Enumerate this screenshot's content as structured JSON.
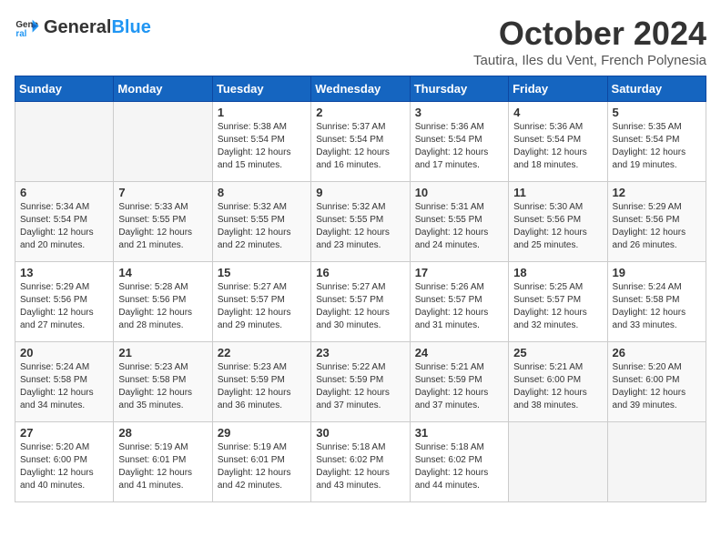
{
  "logo": {
    "general": "General",
    "blue": "Blue"
  },
  "title": "October 2024",
  "location": "Tautira, Iles du Vent, French Polynesia",
  "days_of_week": [
    "Sunday",
    "Monday",
    "Tuesday",
    "Wednesday",
    "Thursday",
    "Friday",
    "Saturday"
  ],
  "weeks": [
    [
      {
        "day": "",
        "sunrise": "",
        "sunset": "",
        "daylight": ""
      },
      {
        "day": "",
        "sunrise": "",
        "sunset": "",
        "daylight": ""
      },
      {
        "day": "1",
        "sunrise": "Sunrise: 5:38 AM",
        "sunset": "Sunset: 5:54 PM",
        "daylight": "Daylight: 12 hours and 15 minutes."
      },
      {
        "day": "2",
        "sunrise": "Sunrise: 5:37 AM",
        "sunset": "Sunset: 5:54 PM",
        "daylight": "Daylight: 12 hours and 16 minutes."
      },
      {
        "day": "3",
        "sunrise": "Sunrise: 5:36 AM",
        "sunset": "Sunset: 5:54 PM",
        "daylight": "Daylight: 12 hours and 17 minutes."
      },
      {
        "day": "4",
        "sunrise": "Sunrise: 5:36 AM",
        "sunset": "Sunset: 5:54 PM",
        "daylight": "Daylight: 12 hours and 18 minutes."
      },
      {
        "day": "5",
        "sunrise": "Sunrise: 5:35 AM",
        "sunset": "Sunset: 5:54 PM",
        "daylight": "Daylight: 12 hours and 19 minutes."
      }
    ],
    [
      {
        "day": "6",
        "sunrise": "Sunrise: 5:34 AM",
        "sunset": "Sunset: 5:54 PM",
        "daylight": "Daylight: 12 hours and 20 minutes."
      },
      {
        "day": "7",
        "sunrise": "Sunrise: 5:33 AM",
        "sunset": "Sunset: 5:55 PM",
        "daylight": "Daylight: 12 hours and 21 minutes."
      },
      {
        "day": "8",
        "sunrise": "Sunrise: 5:32 AM",
        "sunset": "Sunset: 5:55 PM",
        "daylight": "Daylight: 12 hours and 22 minutes."
      },
      {
        "day": "9",
        "sunrise": "Sunrise: 5:32 AM",
        "sunset": "Sunset: 5:55 PM",
        "daylight": "Daylight: 12 hours and 23 minutes."
      },
      {
        "day": "10",
        "sunrise": "Sunrise: 5:31 AM",
        "sunset": "Sunset: 5:55 PM",
        "daylight": "Daylight: 12 hours and 24 minutes."
      },
      {
        "day": "11",
        "sunrise": "Sunrise: 5:30 AM",
        "sunset": "Sunset: 5:56 PM",
        "daylight": "Daylight: 12 hours and 25 minutes."
      },
      {
        "day": "12",
        "sunrise": "Sunrise: 5:29 AM",
        "sunset": "Sunset: 5:56 PM",
        "daylight": "Daylight: 12 hours and 26 minutes."
      }
    ],
    [
      {
        "day": "13",
        "sunrise": "Sunrise: 5:29 AM",
        "sunset": "Sunset: 5:56 PM",
        "daylight": "Daylight: 12 hours and 27 minutes."
      },
      {
        "day": "14",
        "sunrise": "Sunrise: 5:28 AM",
        "sunset": "Sunset: 5:56 PM",
        "daylight": "Daylight: 12 hours and 28 minutes."
      },
      {
        "day": "15",
        "sunrise": "Sunrise: 5:27 AM",
        "sunset": "Sunset: 5:57 PM",
        "daylight": "Daylight: 12 hours and 29 minutes."
      },
      {
        "day": "16",
        "sunrise": "Sunrise: 5:27 AM",
        "sunset": "Sunset: 5:57 PM",
        "daylight": "Daylight: 12 hours and 30 minutes."
      },
      {
        "day": "17",
        "sunrise": "Sunrise: 5:26 AM",
        "sunset": "Sunset: 5:57 PM",
        "daylight": "Daylight: 12 hours and 31 minutes."
      },
      {
        "day": "18",
        "sunrise": "Sunrise: 5:25 AM",
        "sunset": "Sunset: 5:57 PM",
        "daylight": "Daylight: 12 hours and 32 minutes."
      },
      {
        "day": "19",
        "sunrise": "Sunrise: 5:24 AM",
        "sunset": "Sunset: 5:58 PM",
        "daylight": "Daylight: 12 hours and 33 minutes."
      }
    ],
    [
      {
        "day": "20",
        "sunrise": "Sunrise: 5:24 AM",
        "sunset": "Sunset: 5:58 PM",
        "daylight": "Daylight: 12 hours and 34 minutes."
      },
      {
        "day": "21",
        "sunrise": "Sunrise: 5:23 AM",
        "sunset": "Sunset: 5:58 PM",
        "daylight": "Daylight: 12 hours and 35 minutes."
      },
      {
        "day": "22",
        "sunrise": "Sunrise: 5:23 AM",
        "sunset": "Sunset: 5:59 PM",
        "daylight": "Daylight: 12 hours and 36 minutes."
      },
      {
        "day": "23",
        "sunrise": "Sunrise: 5:22 AM",
        "sunset": "Sunset: 5:59 PM",
        "daylight": "Daylight: 12 hours and 37 minutes."
      },
      {
        "day": "24",
        "sunrise": "Sunrise: 5:21 AM",
        "sunset": "Sunset: 5:59 PM",
        "daylight": "Daylight: 12 hours and 37 minutes."
      },
      {
        "day": "25",
        "sunrise": "Sunrise: 5:21 AM",
        "sunset": "Sunset: 6:00 PM",
        "daylight": "Daylight: 12 hours and 38 minutes."
      },
      {
        "day": "26",
        "sunrise": "Sunrise: 5:20 AM",
        "sunset": "Sunset: 6:00 PM",
        "daylight": "Daylight: 12 hours and 39 minutes."
      }
    ],
    [
      {
        "day": "27",
        "sunrise": "Sunrise: 5:20 AM",
        "sunset": "Sunset: 6:00 PM",
        "daylight": "Daylight: 12 hours and 40 minutes."
      },
      {
        "day": "28",
        "sunrise": "Sunrise: 5:19 AM",
        "sunset": "Sunset: 6:01 PM",
        "daylight": "Daylight: 12 hours and 41 minutes."
      },
      {
        "day": "29",
        "sunrise": "Sunrise: 5:19 AM",
        "sunset": "Sunset: 6:01 PM",
        "daylight": "Daylight: 12 hours and 42 minutes."
      },
      {
        "day": "30",
        "sunrise": "Sunrise: 5:18 AM",
        "sunset": "Sunset: 6:02 PM",
        "daylight": "Daylight: 12 hours and 43 minutes."
      },
      {
        "day": "31",
        "sunrise": "Sunrise: 5:18 AM",
        "sunset": "Sunset: 6:02 PM",
        "daylight": "Daylight: 12 hours and 44 minutes."
      },
      {
        "day": "",
        "sunrise": "",
        "sunset": "",
        "daylight": ""
      },
      {
        "day": "",
        "sunrise": "",
        "sunset": "",
        "daylight": ""
      }
    ]
  ]
}
